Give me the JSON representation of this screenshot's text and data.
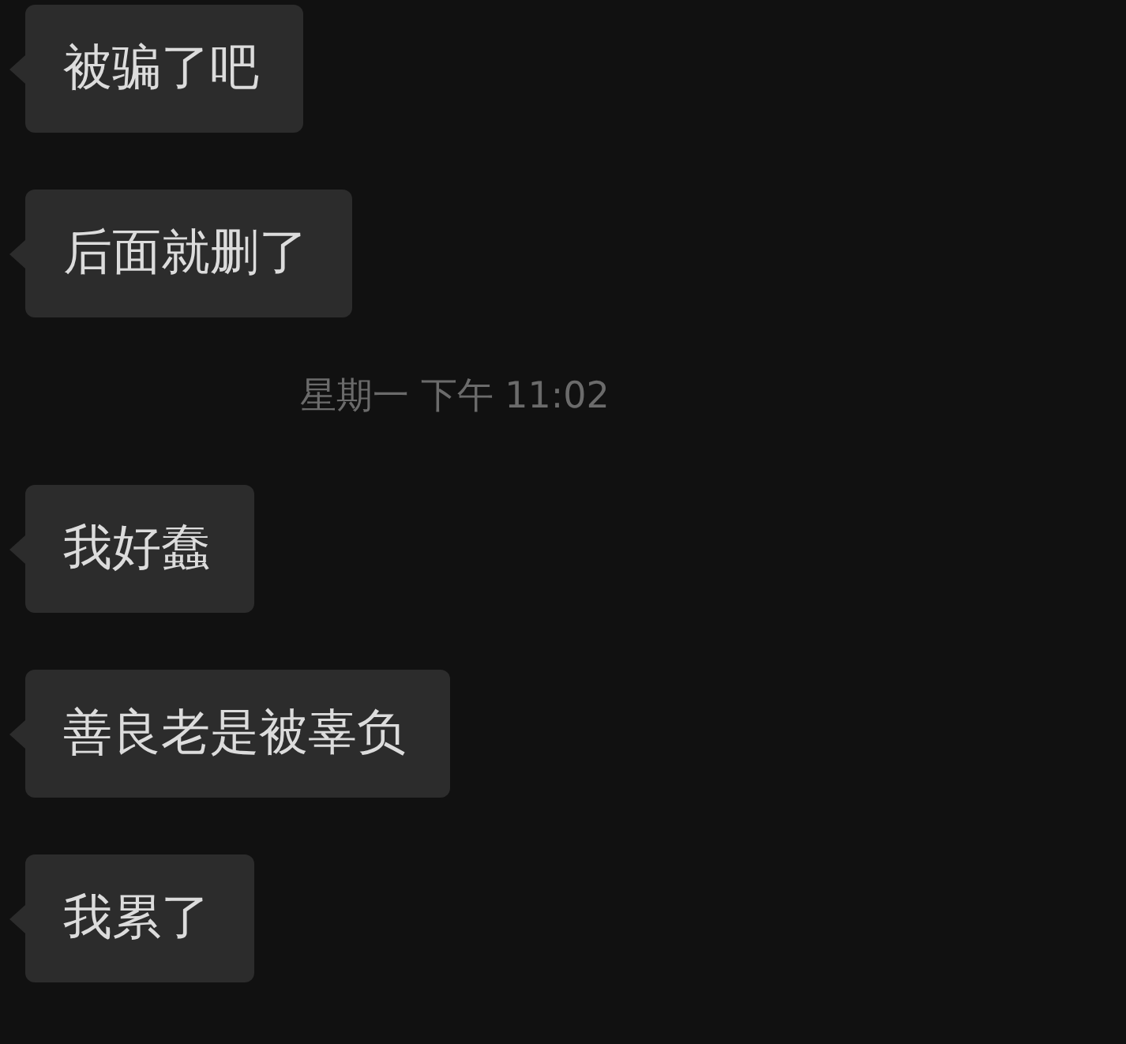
{
  "messages": [
    {
      "kind": "bubble",
      "text": "被骗了吧"
    },
    {
      "kind": "bubble",
      "text": "后面就删了"
    },
    {
      "kind": "timestamp",
      "text": "星期一 下午 11:02"
    },
    {
      "kind": "bubble",
      "text": "我好蠢"
    },
    {
      "kind": "bubble",
      "text": "善良老是被辜负"
    },
    {
      "kind": "bubble",
      "text": "我累了"
    }
  ]
}
